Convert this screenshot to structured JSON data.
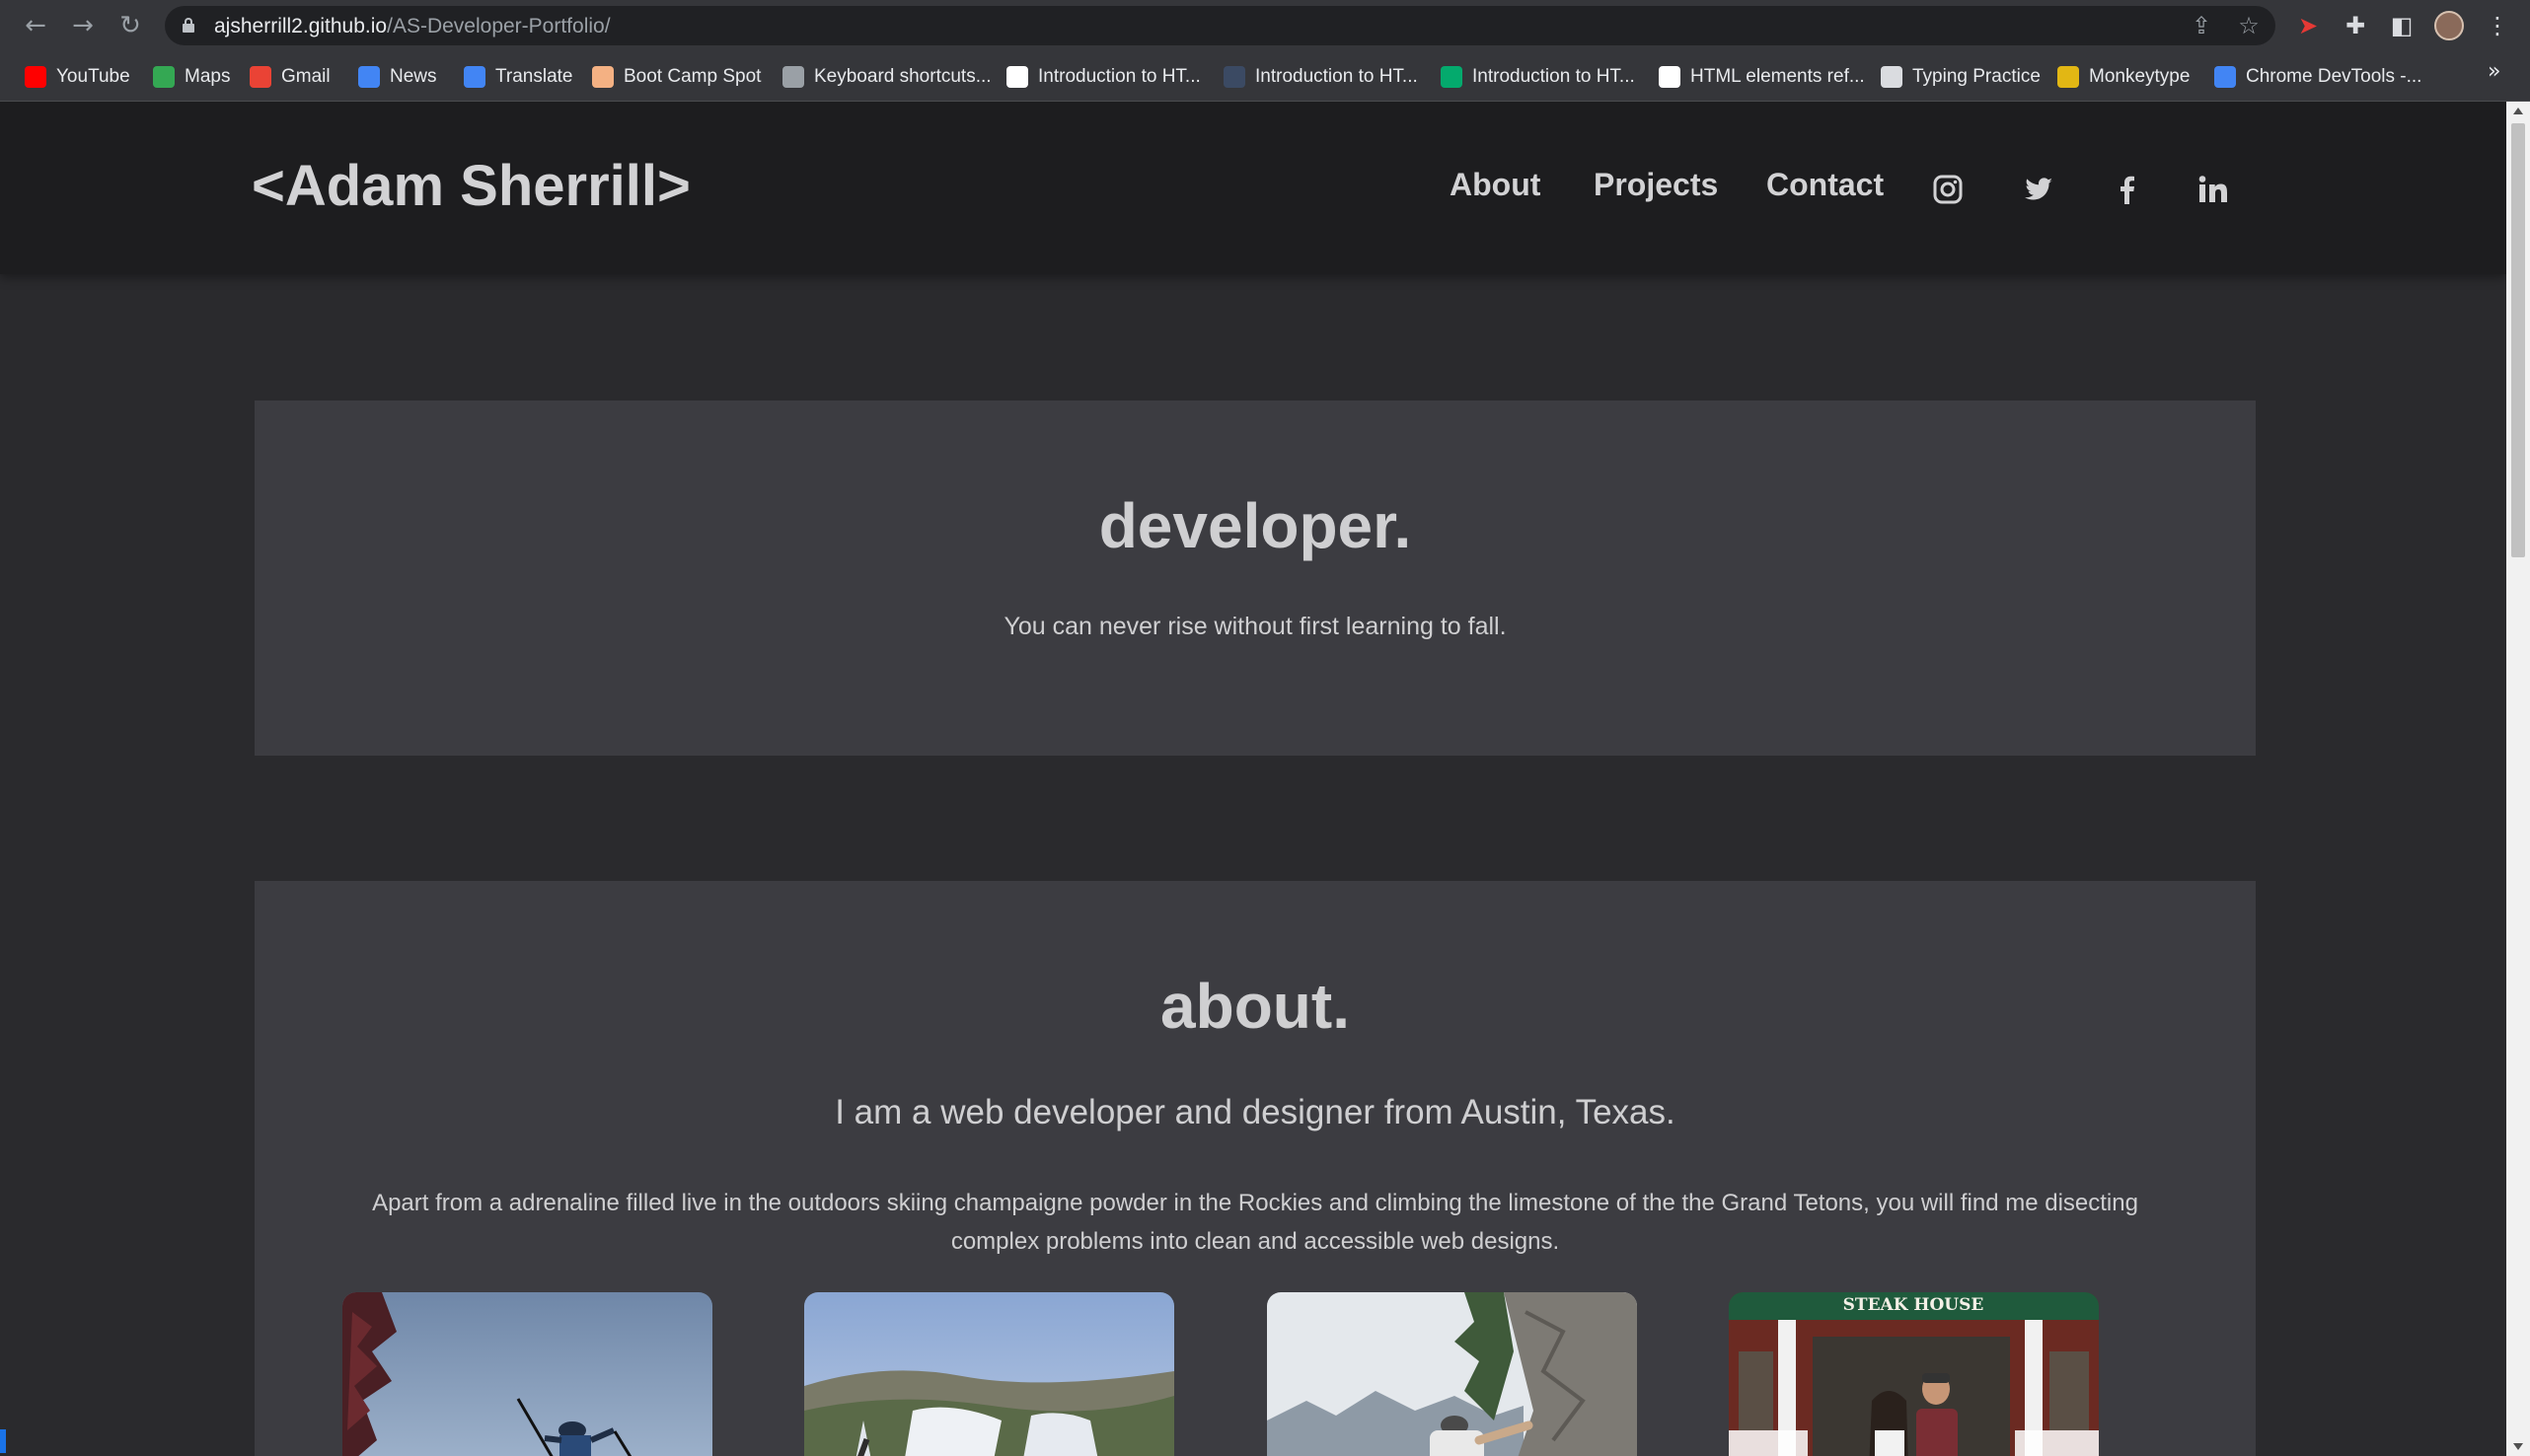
{
  "browser": {
    "url_host": "ajsherrill2.github.io",
    "url_path": "/AS-Developer-Portfolio/",
    "bookmarks": [
      {
        "label": "YouTube",
        "color": "#ff0000"
      },
      {
        "label": "Maps",
        "color": "#34a853"
      },
      {
        "label": "Gmail",
        "color": "#ea4335"
      },
      {
        "label": "News",
        "color": "#4285f4"
      },
      {
        "label": "Translate",
        "color": "#4285f4"
      },
      {
        "label": "Boot Camp Spot",
        "color": "#f4b183"
      },
      {
        "label": "Keyboard shortcuts...",
        "color": "#9aa0a6"
      },
      {
        "label": "Introduction to HT...",
        "color": "#ffffff"
      },
      {
        "label": "Introduction to HT...",
        "color": "#3b4a63"
      },
      {
        "label": "Introduction to HT...",
        "color": "#04aa6d"
      },
      {
        "label": "HTML elements ref...",
        "color": "#ffffff"
      },
      {
        "label": "Typing Practice",
        "color": "#dadce0"
      },
      {
        "label": "Monkeytype",
        "color": "#e2b714"
      },
      {
        "label": "Chrome DevTools -...",
        "color": "#4285f4"
      }
    ],
    "more_bookmarks": "»"
  },
  "header": {
    "brand": "<Adam Sherrill>",
    "nav": [
      "About",
      "Projects",
      "Contact"
    ],
    "social_icons": [
      "instagram-icon",
      "twitter-icon",
      "facebook-icon",
      "linkedin-icon"
    ]
  },
  "hero": {
    "title": "developer.",
    "tagline": "You can never rise without first learning to fall."
  },
  "about": {
    "title": "about.",
    "subhead": "I am a web developer and designer from Austin, Texas.",
    "bio": "Apart from a adrenaline filled live in the outdoors skiing champaigne powder in the Rockies and climbing the limestone of the the Grand Tetons, you will find me disecting complex problems into clean and accessible web designs.",
    "photos": [
      "skier-photo",
      "ski-slope-photo",
      "climber-photo",
      "steak-house-photo"
    ],
    "storefront_sign": "STEAK HOUSE"
  },
  "colors": {
    "header_bg": "#1d1d1f",
    "page_bg": "#2a2a2d",
    "card_bg": "#3c3c41",
    "text": "#cfcfd1"
  }
}
